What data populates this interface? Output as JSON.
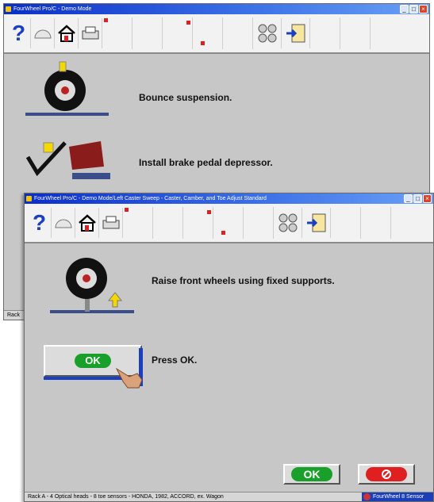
{
  "window1": {
    "title": "FourWheel Pro/C - Demo Mode",
    "steps": [
      {
        "text": "Bounce suspension."
      },
      {
        "text": "Install brake pedal depressor."
      }
    ],
    "status_partial": "Rack"
  },
  "window2": {
    "title": "FourWheel Pro/C - Demo Mode/Left Caster Sweep - Caster, Camber, and Toe Adjust Standard",
    "instruction": "Raise front wheels using fixed supports.",
    "press_ok_label": "Press OK.",
    "ok_example_label": "OK",
    "ok_button_label": "OK",
    "status": "Rack A - 4 Optical heads - 8 toe sensors - HONDA, 1982, ACCORD, ex. Wagon",
    "brand": "FourWheel 8 Sensor"
  },
  "toolbar": {
    "help_symbol": "?"
  },
  "colors": {
    "accent_green": "#18a02a",
    "cancel_red": "#e02020",
    "title_blue": "#0a2ec8"
  }
}
